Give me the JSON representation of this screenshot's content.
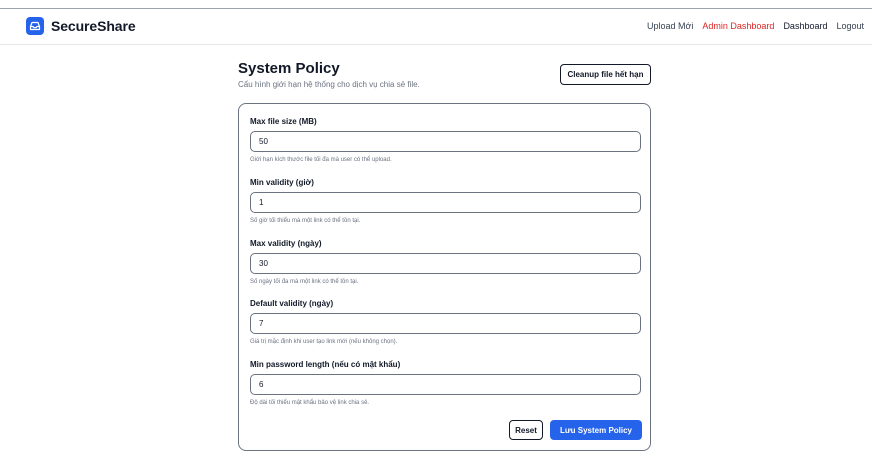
{
  "app": {
    "name": "SecureShare",
    "logo_icon": "inbox-tray-icon",
    "brand_color": "#2563eb"
  },
  "nav": {
    "links": [
      {
        "label": "Upload Mới"
      },
      {
        "label": "Admin Dashboard",
        "color": "#dc2626"
      },
      {
        "label": "Dashboard"
      },
      {
        "label": "Logout"
      }
    ]
  },
  "page": {
    "title": "System Policy",
    "subtitle": "Cấu hình giới hạn hệ thống cho dịch vụ chia sẻ file.",
    "cleanup_label": "Cleanup file hết hạn"
  },
  "form": {
    "fields": [
      {
        "label": "Max file size (MB)",
        "value": "50",
        "help": "Giới hạn kích thước file tối đa mà user có thể upload."
      },
      {
        "label": "Min validity (giờ)",
        "value": "1",
        "help": "Số giờ tối thiểu mà một link có thể tồn tại."
      },
      {
        "label": "Max validity (ngày)",
        "value": "30",
        "help": "Số ngày tối đa mà một link có thể tồn tại."
      },
      {
        "label": "Default validity (ngày)",
        "value": "7",
        "help": "Giá trị mặc định khi user tạo link mới (nếu không chọn)."
      },
      {
        "label": "Min password length (nếu có mật khẩu)",
        "value": "6",
        "help": "Độ dài tối thiểu mật khẩu bảo vệ link chia sẻ."
      }
    ],
    "reset_label": "Reset",
    "save_label": "Lưu System Policy"
  }
}
